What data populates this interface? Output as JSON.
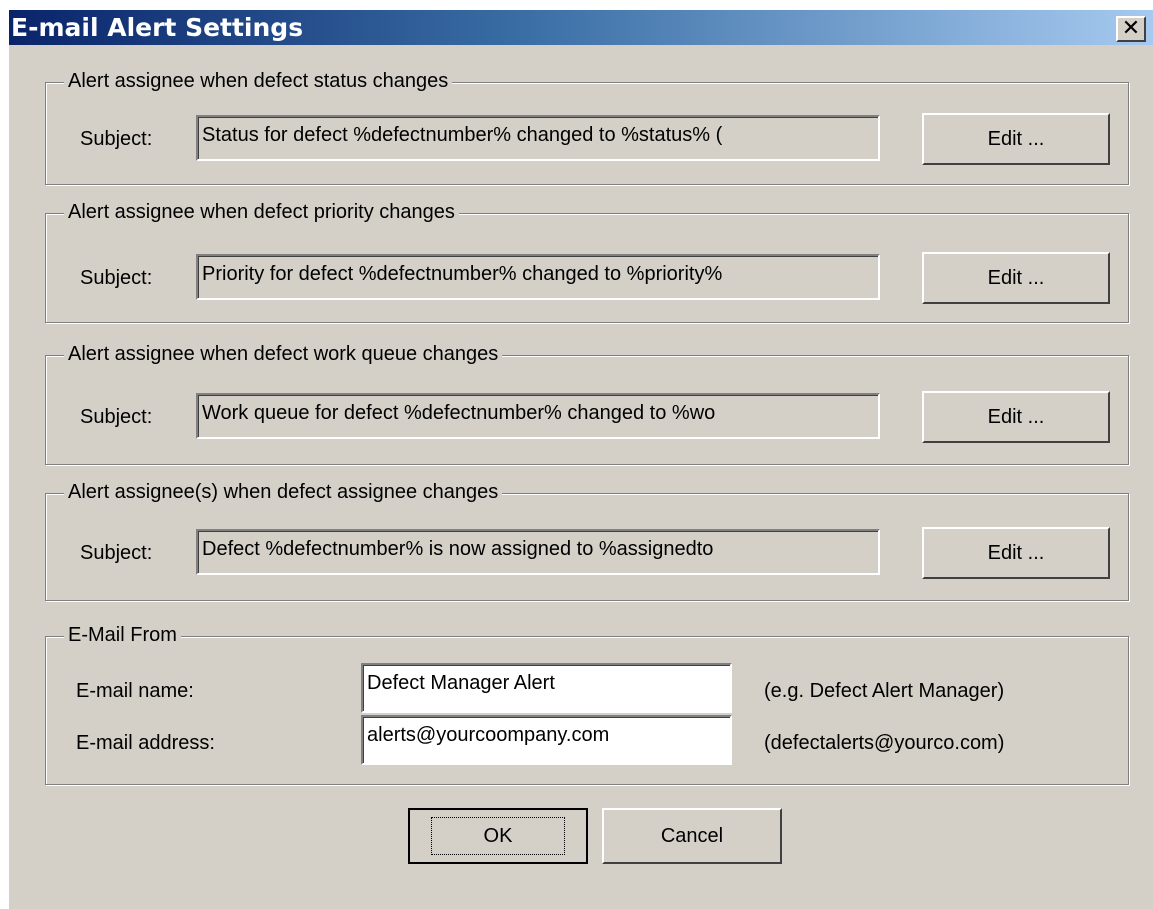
{
  "window": {
    "title": "E-mail Alert Settings",
    "close_label": "✕"
  },
  "alerts": [
    {
      "legend": "Alert assignee when defect status changes",
      "subject_label": "Subject:",
      "subject_value": "Status for defect %defectnumber% changed to %status% (",
      "edit_label": "Edit ..."
    },
    {
      "legend": "Alert assignee when defect priority changes",
      "subject_label": "Subject:",
      "subject_value": "Priority for defect %defectnumber% changed to %priority%",
      "edit_label": "Edit ..."
    },
    {
      "legend": "Alert assignee when defect work queue changes",
      "subject_label": "Subject:",
      "subject_value": "Work queue for defect %defectnumber% changed to %wo",
      "edit_label": "Edit ..."
    },
    {
      "legend": "Alert assignee(s) when defect assignee changes",
      "subject_label": "Subject:",
      "subject_value": "Defect %defectnumber% is now assigned to %assignedto",
      "edit_label": "Edit ..."
    }
  ],
  "email_from": {
    "legend": "E-Mail From",
    "name_label": "E-mail name:",
    "name_value": "Defect Manager Alert",
    "name_hint": "(e.g. Defect Alert Manager)",
    "address_label": "E-mail address:",
    "address_value": "alerts@yourcoompany.com",
    "address_hint": "(defectalerts@yourco.com)"
  },
  "buttons": {
    "ok_label": "OK",
    "cancel_label": "Cancel"
  }
}
